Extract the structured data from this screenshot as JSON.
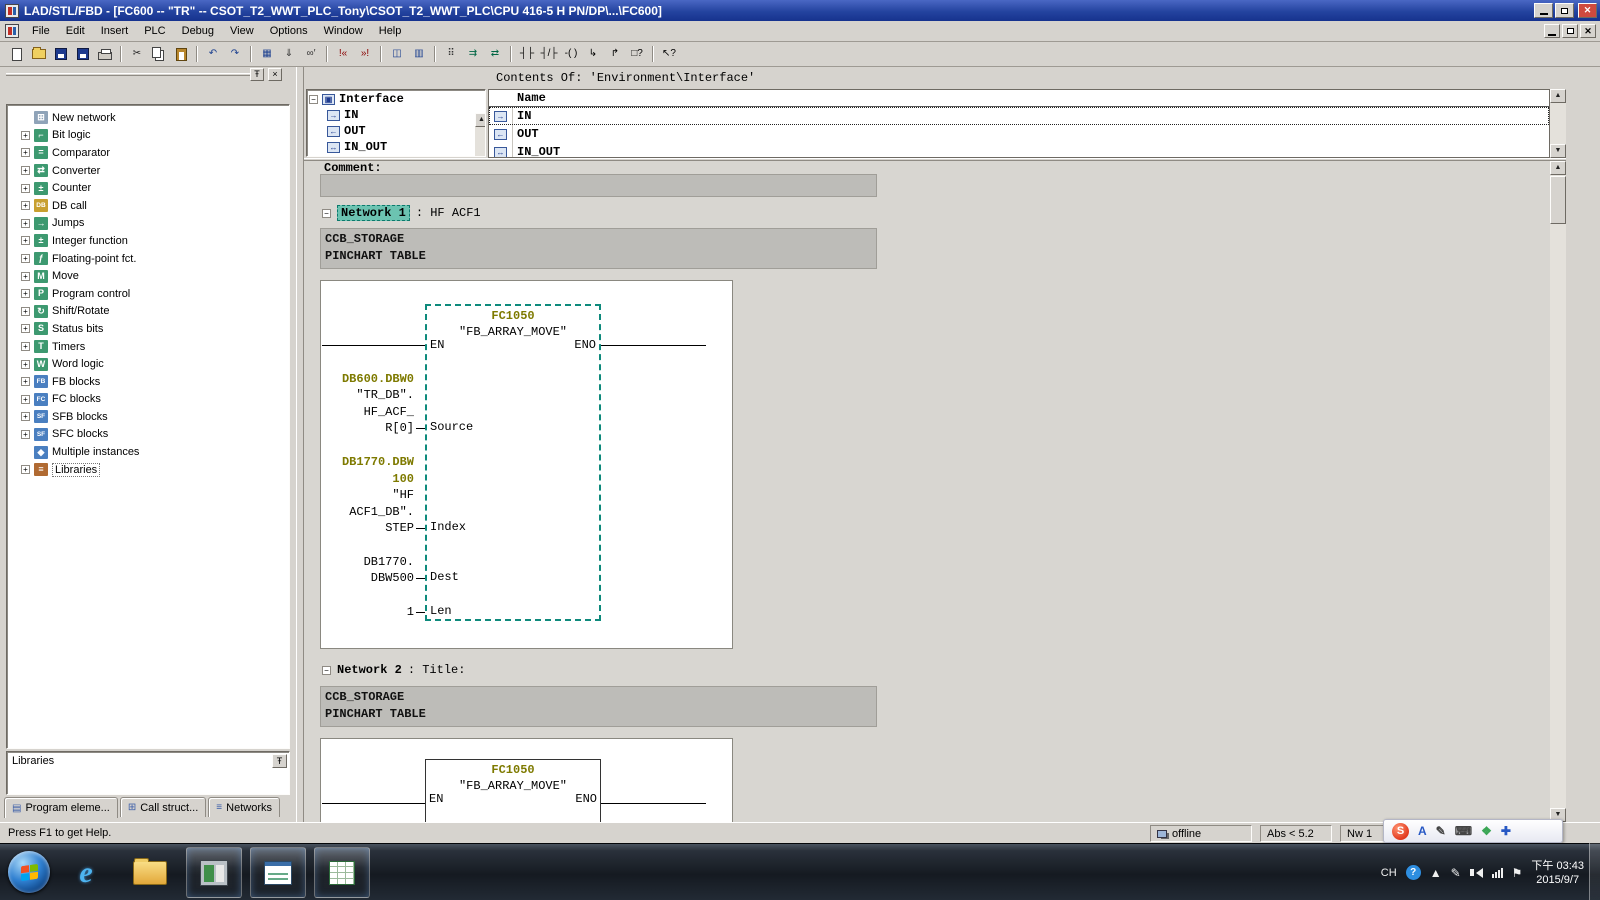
{
  "titlebar": {
    "title": "LAD/STL/FBD  - [FC600 -- \"TR\" -- CSOT_T2_WWT_PLC_Tony\\CSOT_T2_WWT_PLC\\CPU 416-5 H PN/DP\\...\\FC600]"
  },
  "menubar": {
    "items": [
      "File",
      "Edit",
      "Insert",
      "PLC",
      "Debug",
      "View",
      "Options",
      "Window",
      "Help"
    ]
  },
  "toolbar": {
    "items": [
      {
        "button": "new-button",
        "icon": "new-document-icon",
        "css": "i-page"
      },
      {
        "button": "open-button",
        "icon": "open-folder-icon",
        "css": "i-folder"
      },
      {
        "button": "save-as-button",
        "icon": "save-as-icon",
        "css": "i-disk"
      },
      {
        "button": "save-button",
        "icon": "save-icon",
        "css": "i-disk"
      },
      {
        "button": "print-button",
        "icon": "print-icon",
        "css": "i-print"
      },
      {
        "sep": true
      },
      {
        "button": "cut-button",
        "icon": "scissors-icon",
        "glyph": "✂",
        "color": "#222"
      },
      {
        "button": "copy-button",
        "icon": "copy-icon",
        "css": "i-copy"
      },
      {
        "button": "paste-button",
        "icon": "paste-icon",
        "css": "i-paste"
      },
      {
        "sep": true
      },
      {
        "button": "undo-button",
        "icon": "undo-icon",
        "glyph": "↶",
        "color": "#1b3f8f"
      },
      {
        "button": "redo-button",
        "icon": "redo-icon",
        "glyph": "↷",
        "color": "#1b3f8f"
      },
      {
        "sep": true
      },
      {
        "button": "program-elements-button",
        "icon": "program-elements-icon",
        "glyph": "▦",
        "color": "#1b3f8f"
      },
      {
        "button": "download-button",
        "icon": "download-icon",
        "glyph": "⇓",
        "color": "#333"
      },
      {
        "button": "monitor-button",
        "icon": "monitor-glasses-icon",
        "glyph": "∞′",
        "color": "#333"
      },
      {
        "sep": true
      },
      {
        "button": "previous-error-button",
        "icon": "previous-error-icon",
        "glyph": "!«",
        "color": "#8a0000"
      },
      {
        "button": "next-error-button",
        "icon": "next-error-icon",
        "glyph": "»!",
        "color": "#8a0000"
      },
      {
        "sep": true
      },
      {
        "button": "view-overview-button",
        "icon": "overview-icon",
        "glyph": "◫",
        "color": "#1b3f8f"
      },
      {
        "button": "view-detail-button",
        "icon": "detail-view-icon",
        "glyph": "▥",
        "color": "#1b3f8f"
      },
      {
        "sep": true
      },
      {
        "button": "address-grid-button",
        "icon": "address-grid-icon",
        "glyph": "⠿",
        "color": "#333"
      },
      {
        "button": "insert-network-button",
        "icon": "insert-network-icon",
        "glyph": "⇉",
        "color": "#064"
      },
      {
        "button": "network-branch-button",
        "icon": "network-branch-icon",
        "glyph": "⇄",
        "color": "#064"
      },
      {
        "sep": true
      },
      {
        "button": "contact-no-button",
        "icon": "contact-no-icon",
        "glyph": "┤├",
        "color": "#000"
      },
      {
        "button": "contact-nc-button",
        "icon": "contact-nc-icon",
        "glyph": "┤/├",
        "color": "#000"
      },
      {
        "button": "coil-button",
        "icon": "coil-icon",
        "glyph": "-( )",
        "color": "#000"
      },
      {
        "button": "open-branch-button",
        "icon": "open-branch-icon",
        "glyph": "↳",
        "color": "#000"
      },
      {
        "button": "close-branch-button",
        "icon": "close-branch-icon",
        "glyph": "↱",
        "color": "#000"
      },
      {
        "button": "empty-box-button",
        "icon": "empty-box-icon",
        "glyph": "□?",
        "color": "#000"
      },
      {
        "sep": true
      },
      {
        "button": "help-pointer-button",
        "icon": "help-arrow-icon",
        "glyph": "↖?",
        "color": "#000"
      }
    ]
  },
  "palette": {
    "items": [
      {
        "label": "New network",
        "icon": "new-network-icon",
        "glyph": "⊞",
        "bg": "#8fa3b8",
        "expandable": false
      },
      {
        "label": "Bit logic",
        "icon": "bit-logic-icon",
        "glyph": "⌐",
        "bg": "#3d9970",
        "expandable": true
      },
      {
        "label": "Comparator",
        "icon": "comparator-icon",
        "glyph": "=",
        "bg": "#3d9970",
        "expandable": true
      },
      {
        "label": "Converter",
        "icon": "converter-icon",
        "glyph": "⇄",
        "bg": "#3d9970",
        "expandable": true
      },
      {
        "label": "Counter",
        "icon": "counter-icon",
        "glyph": "±",
        "bg": "#3d9970",
        "expandable": true
      },
      {
        "label": "DB call",
        "icon": "db-call-icon",
        "glyph": "DB",
        "bg": "#c8a030",
        "expandable": true
      },
      {
        "label": "Jumps",
        "icon": "jumps-icon",
        "glyph": "→",
        "bg": "#3d9970",
        "expandable": true
      },
      {
        "label": "Integer function",
        "icon": "integer-function-icon",
        "glyph": "±",
        "bg": "#3d9970",
        "expandable": true
      },
      {
        "label": "Floating-point fct.",
        "icon": "floating-point-icon",
        "glyph": "ƒ",
        "bg": "#3d9970",
        "expandable": true
      },
      {
        "label": "Move",
        "icon": "move-icon",
        "glyph": "M",
        "bg": "#3d9970",
        "expandable": true
      },
      {
        "label": "Program control",
        "icon": "program-control-icon",
        "glyph": "P",
        "bg": "#3d9970",
        "expandable": true
      },
      {
        "label": "Shift/Rotate",
        "icon": "shift-rotate-icon",
        "glyph": "↻",
        "bg": "#3d9970",
        "expandable": true
      },
      {
        "label": "Status bits",
        "icon": "status-bits-icon",
        "glyph": "S",
        "bg": "#3d9970",
        "expandable": true
      },
      {
        "label": "Timers",
        "icon": "timers-icon",
        "glyph": "T",
        "bg": "#3d9970",
        "expandable": true
      },
      {
        "label": "Word logic",
        "icon": "word-logic-icon",
        "glyph": "W",
        "bg": "#3d9970",
        "expandable": true
      },
      {
        "label": "FB blocks",
        "icon": "fb-blocks-icon",
        "glyph": "FB",
        "bg": "#4a7fc0",
        "expandable": true
      },
      {
        "label": "FC blocks",
        "icon": "fc-blocks-icon",
        "glyph": "FC",
        "bg": "#4a7fc0",
        "expandable": true
      },
      {
        "label": "SFB blocks",
        "icon": "sfb-blocks-icon",
        "glyph": "SF",
        "bg": "#4a7fc0",
        "expandable": true
      },
      {
        "label": "SFC blocks",
        "icon": "sfc-blocks-icon",
        "glyph": "SF",
        "bg": "#4a7fc0",
        "expandable": true
      },
      {
        "label": "Multiple instances",
        "icon": "multiple-instances-icon",
        "glyph": "◆",
        "bg": "#4a7fc0",
        "expandable": false
      },
      {
        "label": "Libraries",
        "icon": "libraries-icon",
        "glyph": "≡",
        "bg": "#b06a32",
        "expandable": true,
        "selected": true
      }
    ],
    "description_box": "Libraries",
    "tabs": [
      {
        "label": "Program eleme...",
        "icon_glyph": "▤",
        "active": true
      },
      {
        "label": "Call struct...",
        "icon_glyph": "⊞",
        "active": false
      },
      {
        "label": "Networks",
        "icon_glyph": "≡",
        "active": false
      }
    ]
  },
  "interface_panel": {
    "root": "Interface",
    "children": [
      {
        "label": "IN",
        "icon_name": "in-declaration-icon",
        "icon_glyph": "→"
      },
      {
        "label": "OUT",
        "icon_name": "out-declaration-icon",
        "icon_glyph": "←"
      },
      {
        "label": "IN_OUT",
        "icon_name": "inout-declaration-icon",
        "icon_glyph": "↔"
      }
    ],
    "contents_title": "Contents Of:  'Environment\\Interface'",
    "name_header": "Name",
    "rows": [
      {
        "label": "IN",
        "icon_name": "in-declaration-icon",
        "icon_glyph": "→"
      },
      {
        "label": "OUT",
        "icon_name": "out-declaration-icon",
        "icon_glyph": "←"
      },
      {
        "label": "IN_OUT",
        "icon_name": "inout-declaration-icon",
        "icon_glyph": "↔"
      }
    ]
  },
  "editor": {
    "comment_label": "Comment:",
    "network1": {
      "title": "Network 1",
      "suffix": ": HF ACF1",
      "comment": [
        "CCB_STORAGE",
        "PINCHART TABLE"
      ],
      "block": {
        "name": "FC1050",
        "symbol": "\"FB_ARRAY_MOVE\"",
        "en": "EN",
        "eno": "ENO",
        "pins": [
          {
            "pin": "Source",
            "operands": [
              {
                "t": "DB600.DBW0",
                "c": "addr"
              },
              {
                "t": "\"TR_DB\".",
                "c": "sym"
              },
              {
                "t": "HF_ACF_",
                "c": "sym"
              },
              {
                "t": "R[0]",
                "c": "sym"
              }
            ]
          },
          {
            "pin": "Index",
            "operands": [
              {
                "t": "DB1770.DBW",
                "c": "addr"
              },
              {
                "t": "100",
                "c": "addr"
              },
              {
                "t": "\"HF",
                "c": "sym"
              },
              {
                "t": "ACF1_DB\".",
                "c": "sym"
              },
              {
                "t": "STEP",
                "c": "sym"
              }
            ]
          },
          {
            "pin": "Dest",
            "operands": [
              {
                "t": "DB1770.",
                "c": "sym"
              },
              {
                "t": "DBW500",
                "c": "sym"
              }
            ]
          },
          {
            "pin": "Len",
            "operands": [
              {
                "t": "1",
                "c": "sym"
              }
            ]
          }
        ]
      }
    },
    "network2": {
      "title": "Network 2",
      "suffix": ": Title:",
      "comment": [
        "CCB_STORAGE",
        "PINCHART TABLE"
      ],
      "block": {
        "name": "FC1050",
        "symbol": "\"FB_ARRAY_MOVE\"",
        "en": "EN",
        "eno": "ENO"
      }
    }
  },
  "statusbar": {
    "help": "Press F1 to get Help.",
    "connection": "offline",
    "abs": "Abs < 5.2",
    "nw": "Nw 1"
  },
  "sogou": {
    "items": [
      {
        "name": "sogou-logo-icon",
        "kind": "logo",
        "glyph": "S"
      },
      {
        "name": "input-mode-icon",
        "glyph": "A",
        "color": "#2758c4"
      },
      {
        "name": "handwriting-icon",
        "glyph": "✎",
        "color": "#444"
      },
      {
        "name": "keyboard-icon",
        "glyph": "⌨",
        "color": "#444"
      },
      {
        "name": "skin-icon",
        "glyph": "❖",
        "color": "#3aa655"
      },
      {
        "name": "toolbox-icon",
        "glyph": "✚",
        "color": "#2758c4"
      }
    ]
  },
  "taskbar": {
    "apps": [
      {
        "name": "taskbar-ie-button",
        "icon": "internet-explorer-icon",
        "running": false
      },
      {
        "name": "taskbar-explorer-button",
        "icon": "windows-explorer-icon",
        "running": false
      },
      {
        "name": "taskbar-simatic-manager-button",
        "icon": "simatic-manager-icon",
        "running": true
      },
      {
        "name": "taskbar-lad-editor-button",
        "icon": "lad-editor-icon",
        "running": true
      },
      {
        "name": "taskbar-table-window-button",
        "icon": "table-window-icon",
        "running": true
      }
    ],
    "tray_lang": "CH",
    "tray_icons": [
      {
        "name": "ime-help-icon",
        "kind": "help"
      },
      {
        "name": "show-hidden-icons-button",
        "glyph": "▲"
      },
      {
        "name": "ime-pen-icon",
        "glyph": "✎"
      },
      {
        "name": "volume-icon",
        "kind": "volume"
      },
      {
        "name": "network-icon",
        "kind": "network"
      },
      {
        "name": "action-center-icon",
        "glyph": "⚑"
      }
    ],
    "clock_time": "下午 03:43",
    "clock_date": "2015/9/7"
  }
}
